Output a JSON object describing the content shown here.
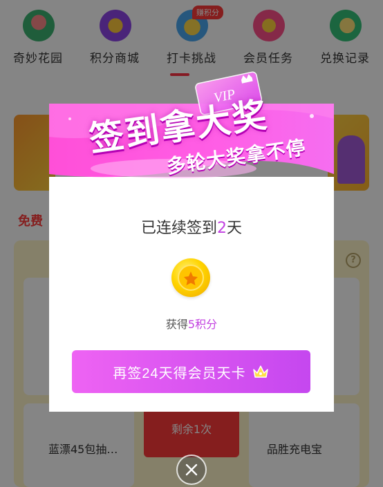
{
  "nav": {
    "items": [
      {
        "label": "奇妙花园",
        "icon": "garden-icon"
      },
      {
        "label": "积分商城",
        "icon": "mall-icon"
      },
      {
        "label": "打卡挑战",
        "icon": "checkin-icon",
        "badge": "赚积分"
      },
      {
        "label": "会员任务",
        "icon": "task-icon"
      },
      {
        "label": "兑换记录",
        "icon": "record-icon"
      }
    ],
    "active_index": 2
  },
  "background": {
    "section_title": "免费",
    "goods": [
      {
        "label": "蓝漂45包抽…"
      },
      {
        "label": "品胜充电宝"
      }
    ],
    "center_tile_text": "剩余1次"
  },
  "modal": {
    "title": "签到拿大奖",
    "subtitle": "多轮大奖拿不停",
    "vip_tag": "VIP",
    "streak_prefix": "已连续签到",
    "streak_days": "2",
    "streak_suffix": "天",
    "earned_prefix": "获得",
    "earned_value": "5积分",
    "cta_label": "再签24天得会员天卡"
  },
  "colors": {
    "accent": "#c23fe0",
    "cta_start": "#ee63f3",
    "cta_end": "#c547ef",
    "nav_active": "#ff3344"
  }
}
